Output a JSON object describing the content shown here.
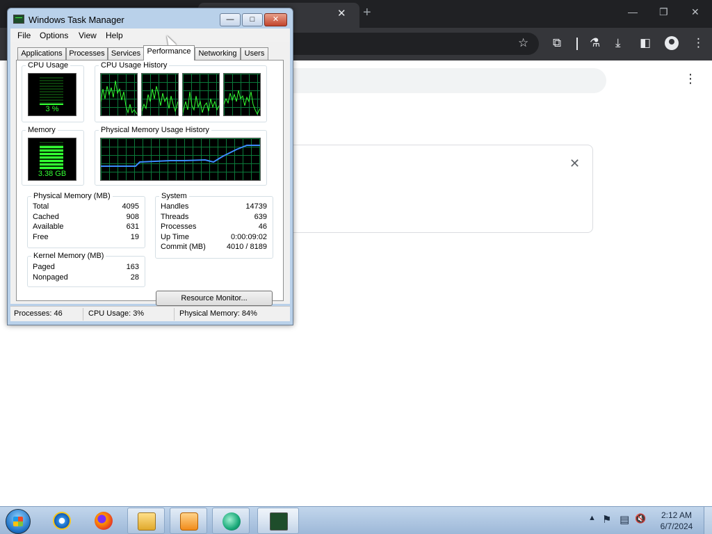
{
  "browser": {
    "tab_close": "✕",
    "new_tab": "+",
    "window_controls": [
      "—",
      "❐",
      "✕"
    ],
    "toolbar_icons": [
      "star-icon",
      "extensions-icon",
      "labs-icon",
      "download-icon",
      "side-panel-icon",
      "profile-icon",
      "menu-icon"
    ],
    "toolbar_glyphs": {
      "star": "☆",
      "extensions": "⧉",
      "labs": "⚗",
      "download": "⤓",
      "side_panel": "◧",
      "menu": "⋮"
    },
    "page_kebab": "⋮",
    "card_close": "✕"
  },
  "task_manager": {
    "title": "Windows Task Manager",
    "controls": {
      "minimize": "—",
      "maximize": "□",
      "close": "✕"
    },
    "menu": [
      "File",
      "Options",
      "View",
      "Help"
    ],
    "tabs": [
      "Applications",
      "Processes",
      "Services",
      "Performance",
      "Networking",
      "Users"
    ],
    "active_tab": "Performance",
    "cpu_usage": {
      "label": "CPU Usage",
      "value": "3 %",
      "level": 0.03
    },
    "cpu_history": {
      "label": "CPU Usage History",
      "cores": 4
    },
    "memory": {
      "label": "Memory",
      "value": "3.38 GB",
      "level": 0.84
    },
    "memory_history": {
      "label": "Physical Memory Usage History"
    },
    "physical_memory": {
      "label": "Physical Memory (MB)",
      "rows": [
        {
          "label": "Total",
          "value": "4095"
        },
        {
          "label": "Cached",
          "value": "908"
        },
        {
          "label": "Available",
          "value": "631"
        },
        {
          "label": "Free",
          "value": "19"
        }
      ]
    },
    "kernel_memory": {
      "label": "Kernel Memory (MB)",
      "rows": [
        {
          "label": "Paged",
          "value": "163"
        },
        {
          "label": "Nonpaged",
          "value": "28"
        }
      ]
    },
    "system": {
      "label": "System",
      "rows": [
        {
          "label": "Handles",
          "value": "14739"
        },
        {
          "label": "Threads",
          "value": "639"
        },
        {
          "label": "Processes",
          "value": "46"
        },
        {
          "label": "Up Time",
          "value": "0:00:09:02"
        },
        {
          "label": "Commit (MB)",
          "value": "4010 / 8189"
        }
      ]
    },
    "resource_monitor_button": "Resource Monitor...",
    "status": {
      "processes": "Processes: 46",
      "cpu": "CPU Usage: 3%",
      "memory": "Physical Memory: 84%"
    }
  },
  "taskbar": {
    "start": "start-orb-icon",
    "pinned": [
      "internet-explorer-icon",
      "firefox-icon",
      "file-explorer-icon",
      "media-player-icon",
      "app-icon",
      "task-manager-icon"
    ],
    "tray": {
      "show_hidden": "▲",
      "icons": [
        "action-center-flag-icon",
        "network-icon",
        "volume-muted-icon"
      ],
      "glyphs": {
        "flag": "⚑",
        "network": "▤",
        "volume": "🔇"
      }
    },
    "clock": {
      "time": "2:12 AM",
      "date": "6/7/2024"
    }
  }
}
